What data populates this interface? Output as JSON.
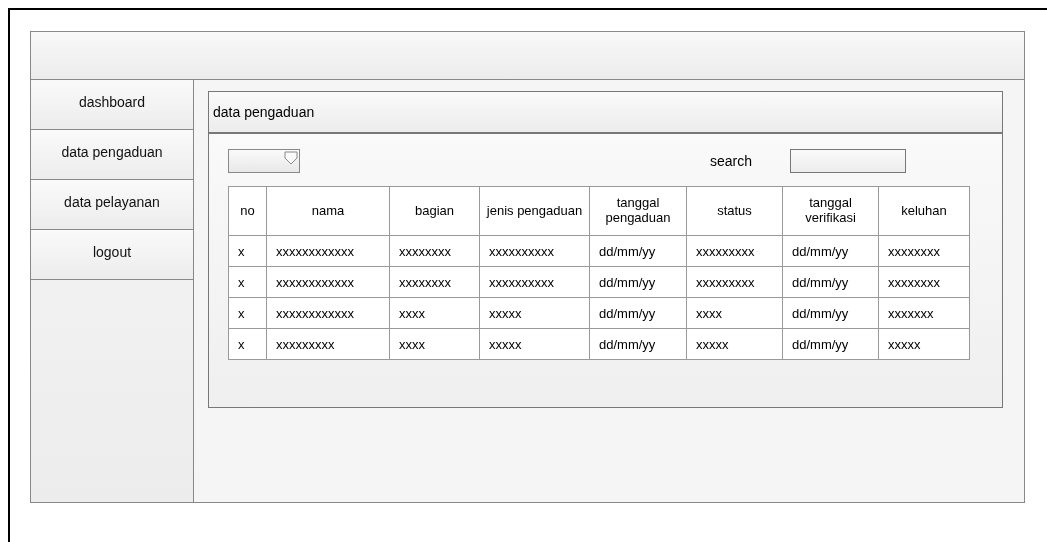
{
  "sidebar": {
    "items": [
      "dashboard",
      "data pengaduan",
      "data pelayanan",
      "logout"
    ]
  },
  "panel": {
    "title": "data pengaduan",
    "search_label": "search"
  },
  "table": {
    "columns": [
      "no",
      "nama",
      "bagian",
      "jenis pengaduan",
      "tanggal pengaduan",
      "status",
      "tanggal verifikasi",
      "keluhan"
    ],
    "rows": [
      [
        "x",
        "xxxxxxxxxxxx",
        "xxxxxxxx",
        "xxxxxxxxxx",
        "dd/mm/yy",
        "xxxxxxxxx",
        "dd/mm/yy",
        "xxxxxxxx"
      ],
      [
        "x",
        "xxxxxxxxxxxx",
        "xxxxxxxx",
        "xxxxxxxxxx",
        "dd/mm/yy",
        "xxxxxxxxx",
        "dd/mm/yy",
        "xxxxxxxx"
      ],
      [
        "x",
        "xxxxxxxxxxxx",
        "xxxx",
        "xxxxx",
        "dd/mm/yy",
        "xxxx",
        "dd/mm/yy",
        "xxxxxxx"
      ],
      [
        "x",
        "xxxxxxxxx",
        "xxxx",
        "xxxxx",
        "dd/mm/yy",
        "xxxxx",
        "dd/mm/yy",
        "xxxxx"
      ]
    ]
  }
}
